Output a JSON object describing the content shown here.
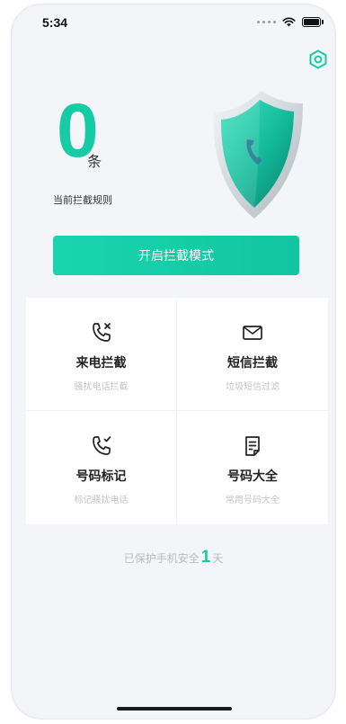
{
  "status_bar": {
    "time": "5:34",
    "icons": [
      "signal-dots-icon",
      "wifi-icon",
      "battery-icon"
    ]
  },
  "header": {
    "settings_icon": "hexagon-settings-icon"
  },
  "stats": {
    "count": "0",
    "unit": "条",
    "label": "当前拦截规则"
  },
  "shield": {
    "icon": "shield-phone-icon",
    "colors": {
      "primary": "#17cba5",
      "dark": "#0b8f7c",
      "outline": "#d9e0e3"
    }
  },
  "action": {
    "start_label": "开启拦截模式"
  },
  "features": [
    {
      "title": "来电拦截",
      "subtitle": "骚扰电话拦截",
      "icon": "phone-block-icon"
    },
    {
      "title": "短信拦截",
      "subtitle": "垃圾短信过滤",
      "icon": "envelope-icon"
    },
    {
      "title": "号码标记",
      "subtitle": "标记骚扰电话",
      "icon": "phone-check-icon"
    },
    {
      "title": "号码大全",
      "subtitle": "常用号码大全",
      "icon": "document-icon"
    }
  ],
  "footer": {
    "prefix": "已保护手机安全",
    "days": "1",
    "suffix": "天"
  },
  "colors": {
    "accent": "#17cba5",
    "background": "#f3f5f8",
    "text_muted": "#c2c4c8"
  }
}
